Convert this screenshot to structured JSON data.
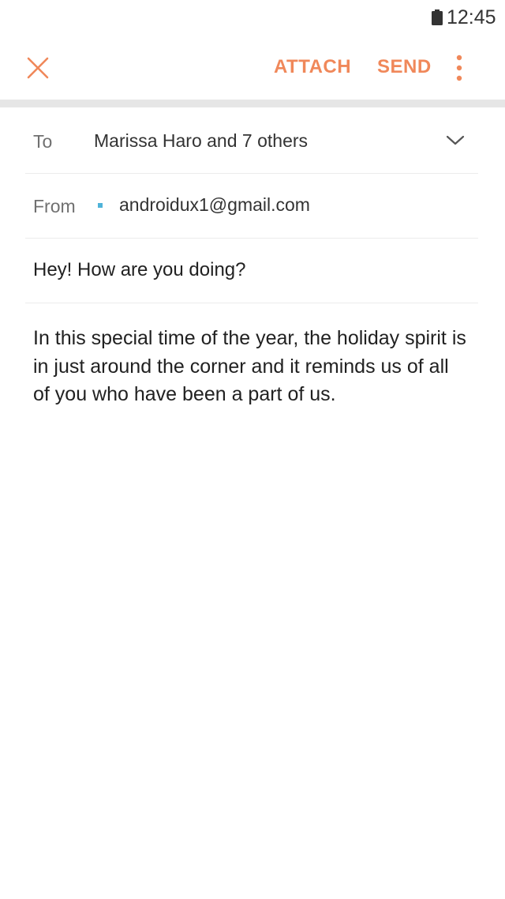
{
  "status_bar": {
    "time": "12:45",
    "battery_icon": "battery-icon"
  },
  "app_bar": {
    "close_icon": "close-icon",
    "attach_label": "ATTACH",
    "send_label": "SEND",
    "more_icon": "more-vertical-icon"
  },
  "compose": {
    "to_label": "To",
    "to_value": "Marissa Haro and 7 others",
    "expand_icon": "chevron-down-icon",
    "from_label": "From",
    "from_value": "androidux1@gmail.com",
    "subject": "Hey! How are you doing?",
    "body": "In this special time of the year, the holiday spirit is in just around the corner and it reminds us of all of you who have been a part of us."
  },
  "colors": {
    "accent": "#f0885a",
    "account_dot": "#4fb3d9",
    "divider": "#e6e6e6"
  }
}
